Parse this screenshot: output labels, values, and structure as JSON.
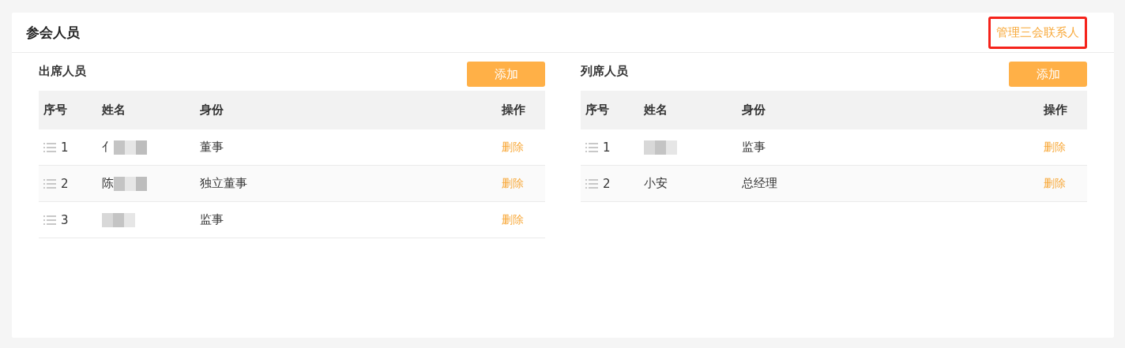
{
  "card": {
    "title": "参会人员",
    "link": {
      "label": "管理三会联系人",
      "highlighted": true
    }
  },
  "sections": [
    {
      "title": "出席人员",
      "add_button": "添加",
      "columns": [
        "序号",
        "姓名",
        "身份",
        "操作"
      ],
      "rows": [
        {
          "index": "1",
          "name": {
            "visible_text": "亻",
            "redacted": true
          },
          "role": "董事",
          "action": "删除"
        },
        {
          "index": "2",
          "name": {
            "visible_text": "陈",
            "redacted": true
          },
          "role": "独立董事",
          "action": "删除"
        },
        {
          "index": "3",
          "name": {
            "redacted": true
          },
          "role": "监事",
          "action": "删除"
        }
      ]
    },
    {
      "title": "列席人员",
      "add_button": "添加",
      "columns": [
        "序号",
        "姓名",
        "身份",
        "操作"
      ],
      "rows": [
        {
          "index": "1",
          "name": {
            "redacted": true
          },
          "role": "监事",
          "action": "删除"
        },
        {
          "index": "2",
          "name": {
            "visible_text": "小安",
            "redacted": false
          },
          "role": "总经理",
          "action": "删除"
        }
      ]
    }
  ]
}
